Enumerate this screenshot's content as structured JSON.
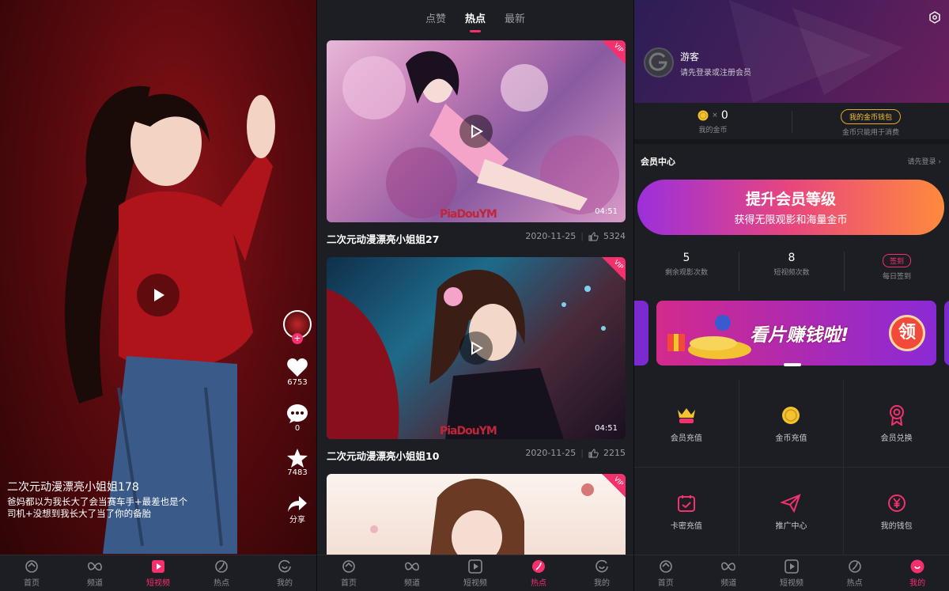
{
  "tabbar": {
    "items": [
      {
        "label": "首页",
        "icon": "home-icon"
      },
      {
        "label": "频道",
        "icon": "channel-icon"
      },
      {
        "label": "短视频",
        "icon": "short-video-icon"
      },
      {
        "label": "热点",
        "icon": "hot-icon"
      },
      {
        "label": "我的",
        "icon": "profile-icon"
      }
    ],
    "accent": "#f4306d"
  },
  "screen1": {
    "like_count": "6753",
    "comment_count": "0",
    "favorite_count": "7483",
    "share_label": "分享",
    "video_title": "二次元动漫漂亮小姐姐178",
    "video_desc": "爸妈都以为我长大了会当赛车手+最差也是个司机+没想到我长大了当了你的备胎"
  },
  "screen2": {
    "tabs": [
      "点赞",
      "热点",
      "最新"
    ],
    "active_tab": "热点",
    "cards": [
      {
        "title": "二次元动漫漂亮小姐姐27",
        "date": "2020-11-25",
        "likes": "5324",
        "duration": "04:51",
        "watermark": "PiaDouYM",
        "badge": "VIP"
      },
      {
        "title": "二次元动漫漂亮小姐姐10",
        "date": "2020-11-25",
        "likes": "2215",
        "duration": "04:51",
        "watermark": "PiaDouYM",
        "badge": "VIP"
      },
      {
        "badge": "VIP"
      }
    ]
  },
  "screen3": {
    "user_name": "游客",
    "user_sub": "请先登录或注册会员",
    "coin_count": "0",
    "coin_x": "×",
    "coin_label": "我的金币",
    "wallet_button": "我的金币钱包",
    "wallet_note": "金币只能用于消费",
    "member_center": "会员中心",
    "login_prompt": "请先登录",
    "promo_title": "提升会员等级",
    "promo_sub": "获得无限观影和海量金币",
    "stats": [
      {
        "value": "5",
        "label": "剩余观影次数"
      },
      {
        "value": "8",
        "label": "短视频次数"
      },
      {
        "value": "签到",
        "label": "每日签到"
      }
    ],
    "banner_text": "看片赚钱啦!",
    "banner_badge": "领",
    "grid": [
      {
        "label": "会员充值",
        "icon": "vip-crown-icon"
      },
      {
        "label": "金币充值",
        "icon": "coin-icon"
      },
      {
        "label": "会员兑换",
        "icon": "medal-icon"
      },
      {
        "label": "卡密充值",
        "icon": "calendar-card-icon"
      },
      {
        "label": "推广中心",
        "icon": "paper-plane-icon"
      },
      {
        "label": "我的钱包",
        "icon": "wallet-yen-icon"
      }
    ]
  }
}
